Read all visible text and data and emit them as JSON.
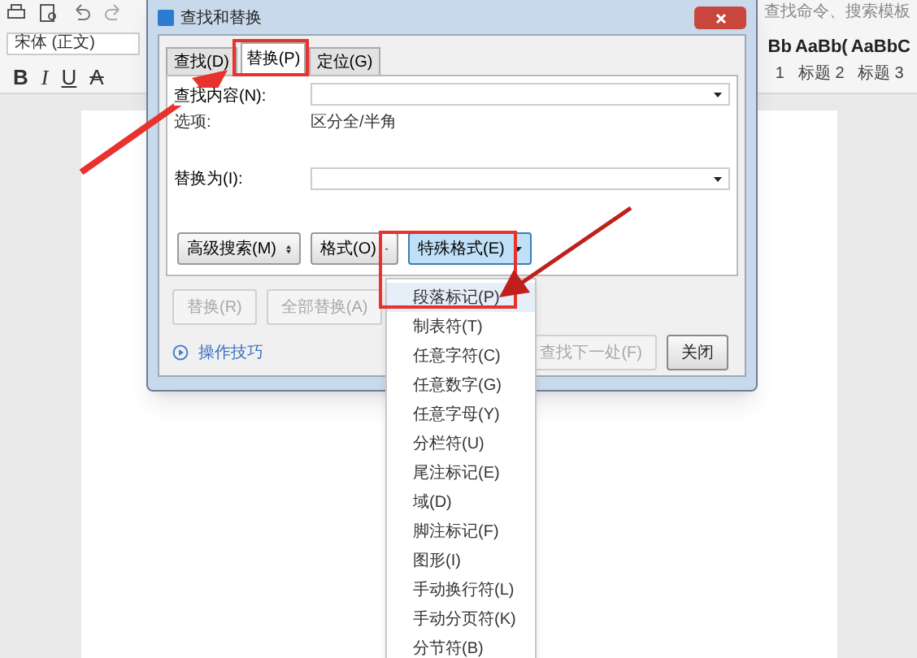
{
  "app": {
    "font_box": "宋体 (正文)",
    "format_buttons": [
      "B",
      "I",
      "U",
      "A"
    ],
    "search_placeholder": "查找命令、搜索模板",
    "styles": [
      {
        "sample": "Bb",
        "label": "1"
      },
      {
        "sample": "AaBb(",
        "label": "标题 2"
      },
      {
        "sample": "AaBbC",
        "label": "标题 3"
      }
    ]
  },
  "dialog": {
    "title": "查找和替换",
    "tabs": [
      {
        "label": "查找(D)",
        "selected": false
      },
      {
        "label": "替换(P)",
        "selected": true
      },
      {
        "label": "定位(G)",
        "selected": false
      }
    ],
    "find_label": "查找内容(N):",
    "options_label": "选项:",
    "options_value": "区分全/半角",
    "replace_label": "替换为(I):",
    "buttons": [
      {
        "label": "高级搜索(M)",
        "kind": "spin",
        "selected": false
      },
      {
        "label": "格式(O)",
        "kind": "dropdown",
        "selected": false
      },
      {
        "label": "特殊格式(E)",
        "kind": "dropdown",
        "selected": true
      }
    ],
    "action_buttons": [
      {
        "label": "替换(R)",
        "disabled": true
      },
      {
        "label": "全部替换(A)",
        "disabled": true
      }
    ],
    "tips_link": "操作技巧",
    "footer_buttons": [
      {
        "label": "查找下一处(F)",
        "disabled": true
      },
      {
        "label": "关闭",
        "disabled": false
      }
    ]
  },
  "menu": {
    "items": [
      {
        "label": "段落标记(P)",
        "selected": true
      },
      {
        "label": "制表符(T)",
        "selected": false
      },
      {
        "label": "任意字符(C)",
        "selected": false
      },
      {
        "label": "任意数字(G)",
        "selected": false
      },
      {
        "label": "任意字母(Y)",
        "selected": false
      },
      {
        "label": "分栏符(U)",
        "selected": false
      },
      {
        "label": "尾注标记(E)",
        "selected": false
      },
      {
        "label": "域(D)",
        "selected": false
      },
      {
        "label": "脚注标记(F)",
        "selected": false
      },
      {
        "label": "图形(I)",
        "selected": false
      },
      {
        "label": "手动换行符(L)",
        "selected": false
      },
      {
        "label": "手动分页符(K)",
        "selected": false
      },
      {
        "label": "分节符(B)",
        "selected": false
      }
    ]
  }
}
